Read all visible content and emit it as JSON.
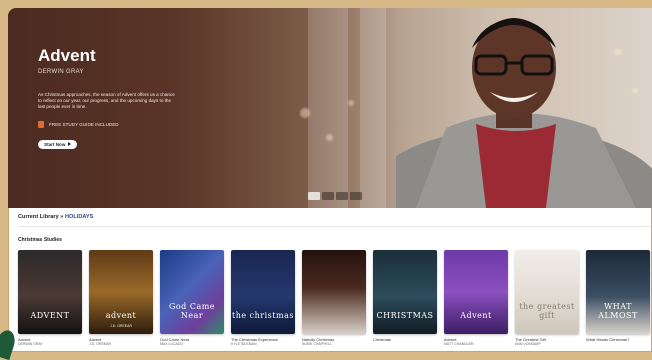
{
  "hero": {
    "title": "Advent",
    "author": "DERWIN GRAY",
    "description": "As Christmas approaches, the season of Advent offers us a chance to reflect on our year, our progress, and the upcoming days to the last people ever in time.",
    "bundle": "FREE STUDY GUIDE INCLUDED",
    "button_label": "Start Now",
    "pager_count": 4,
    "pager_active": 0
  },
  "library": {
    "prefix": "Current Library",
    "separator": "»",
    "highlight": "HOLIDAYS"
  },
  "section": {
    "title": "Christmas Studies"
  },
  "covers": [
    {
      "cover_text": "ADVENT",
      "cover_sub": "",
      "title": "Advent",
      "author": "DERWIN GRAY",
      "bg": "linear-gradient(180deg,#2c2a2a 0%,#4b3a35 55%,#121212 100%)"
    },
    {
      "cover_text": "advent",
      "cover_sub": "J.D. GREEAR",
      "title": "Advent",
      "author": "J.D. GREEAR",
      "bg": "linear-gradient(180deg,#5f3a17 0%,#9a6a28 50%,#2c1c0c 100%)"
    },
    {
      "cover_text": "God Came Near",
      "cover_sub": "",
      "title": "God Came Near",
      "author": "MAX LUCADO",
      "bg": "linear-gradient(135deg,#1c3b85 0%,#4963b8 45%,#6f3f9d 75%,#2f8a6a 100%)"
    },
    {
      "cover_text": "the christmas",
      "cover_sub": "",
      "title": "The Christmas Experience",
      "author": "KYLE IDLEMAN",
      "bg": "linear-gradient(180deg,#1a2650 0%,#24386e 55%,#0e1a3a 100%)"
    },
    {
      "cover_text": "",
      "cover_sub": "",
      "title": "Nativity Christmas",
      "author": "SUSIE CHAPPELL",
      "bg": "linear-gradient(180deg,#24120e 0%,#4a2a20 45%,#d9d0c6 100%)"
    },
    {
      "cover_text": "CHRISTMAS",
      "cover_sub": "",
      "title": "Christmas",
      "author": "",
      "bg": "linear-gradient(180deg,#1b2e3a 0%,#2d4c5c 55%,#101c24 100%)"
    },
    {
      "cover_text": "Advent",
      "cover_sub": "",
      "title": "Advent",
      "author": "MATT CHANDLER",
      "bg": "linear-gradient(180deg,#6d3aa6 0%,#8c4fc0 50%,#3b1e63 100%)"
    },
    {
      "cover_text": "the greatest gift",
      "cover_sub": "",
      "title": "The Greatest Gift",
      "author": "ANN VOSKAMP",
      "bg": "linear-gradient(180deg,#f1ede8 0%,#e2dcd3 55%,#cfc7bc 100%)"
    },
    {
      "cover_text": "WHAT ALMOST",
      "cover_sub": "",
      "title": "What Heads Christmas?",
      "author": "",
      "bg": "linear-gradient(180deg,#1c2838 0%,#3b4e62 55%,#d8d3cc 100%)"
    }
  ]
}
